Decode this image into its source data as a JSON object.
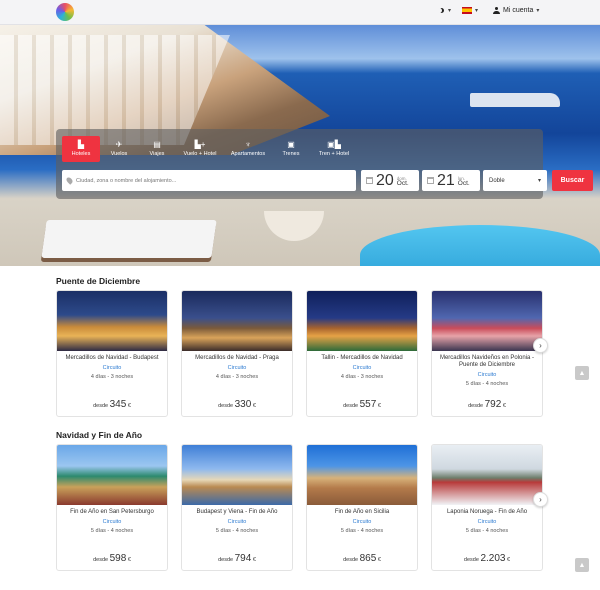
{
  "header": {
    "theme_label": "",
    "language_flag": "es",
    "account_label": "Mi cuenta"
  },
  "search": {
    "tabs": [
      {
        "label": "Hoteles",
        "icon": "building-icon"
      },
      {
        "label": "Vuelos",
        "icon": "plane-icon"
      },
      {
        "label": "Viajes",
        "icon": "suitcase-icon"
      },
      {
        "label": "Vuelo + Hotel",
        "icon": "plane-hotel-icon"
      },
      {
        "label": "Apartamentos",
        "icon": "lamp-icon"
      },
      {
        "label": "Trenes",
        "icon": "train-icon"
      },
      {
        "label": "Tren + Hotel",
        "icon": "train-hotel-icon"
      }
    ],
    "destination_placeholder": "Ciudad, zona o nombre del alojamiento...",
    "checkin": {
      "day": "20",
      "weekday": "dom.",
      "month": "Oct."
    },
    "checkout": {
      "day": "21",
      "weekday": "lun.",
      "month": "Oct."
    },
    "room_type": "Doble",
    "submit_label": "Buscar"
  },
  "sections": [
    {
      "title": "Puente de Diciembre",
      "cards": [
        {
          "name": "Mercadillos de Navidad - Budapest",
          "type": "Circuito",
          "duration": "4 días - 3 noches",
          "price_prefix": "desde",
          "price": "345",
          "currency": "€"
        },
        {
          "name": "Mercadillos de Navidad - Praga",
          "type": "Circuito",
          "duration": "4 días - 3 noches",
          "price_prefix": "desde",
          "price": "330",
          "currency": "€"
        },
        {
          "name": "Tallin - Mercadillos de Navidad",
          "type": "Circuito",
          "duration": "4 días - 3 noches",
          "price_prefix": "desde",
          "price": "557",
          "currency": "€"
        },
        {
          "name": "Mercadillos Navideños en Polonia - Puente de Diciembre",
          "type": "Circuito",
          "duration": "5 días - 4 noches",
          "price_prefix": "desde",
          "price": "792",
          "currency": "€"
        }
      ]
    },
    {
      "title": "Navidad y Fin de Año",
      "cards": [
        {
          "name": "Fin de Año en San Petersburgo",
          "type": "Circuito",
          "duration": "5 días - 4 noches",
          "price_prefix": "desde",
          "price": "598",
          "currency": "€"
        },
        {
          "name": "Budapest y Viena - Fin de Año",
          "type": "Circuito",
          "duration": "5 días - 4 noches",
          "price_prefix": "desde",
          "price": "794",
          "currency": "€"
        },
        {
          "name": "Fin de Año en Sicilia",
          "type": "Circuito",
          "duration": "5 días - 4 noches",
          "price_prefix": "desde",
          "price": "865",
          "currency": "€"
        },
        {
          "name": "Laponia Noruega - Fin de Año",
          "type": "Circuito",
          "duration": "5 días - 4 noches",
          "price_prefix": "desde",
          "price": "2.203",
          "currency": "€"
        }
      ]
    }
  ],
  "colors": {
    "accent": "#ef3340",
    "link": "#2b7ad1"
  }
}
